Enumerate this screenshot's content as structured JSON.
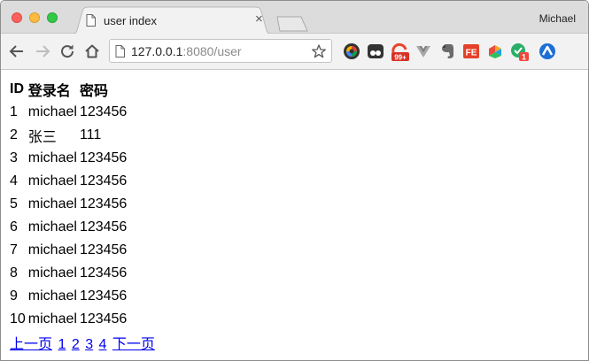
{
  "tab": {
    "title": "user index",
    "close": "×"
  },
  "profile": {
    "name": "Michael"
  },
  "address": {
    "host": "127.0.0.1",
    "port_path": ":8080/user"
  },
  "extensions": {
    "badge_mail": "99+",
    "badge_wechat": "1",
    "label_fe": "FE"
  },
  "table": {
    "headers": [
      "ID",
      "登录名",
      "密码"
    ],
    "rows": [
      [
        "1",
        "michael",
        "123456"
      ],
      [
        "2",
        "张三",
        "111"
      ],
      [
        "3",
        "michael",
        "123456"
      ],
      [
        "4",
        "michael",
        "123456"
      ],
      [
        "5",
        "michael",
        "123456"
      ],
      [
        "6",
        "michael",
        "123456"
      ],
      [
        "7",
        "michael",
        "123456"
      ],
      [
        "8",
        "michael",
        "123456"
      ],
      [
        "9",
        "michael",
        "123456"
      ],
      [
        "10",
        "michael",
        "123456"
      ]
    ]
  },
  "pagination": {
    "prev": "上一页",
    "pages": [
      "1",
      "2",
      "3",
      "4"
    ],
    "next": "下一页"
  },
  "colors": {
    "link": "#0000ee"
  }
}
